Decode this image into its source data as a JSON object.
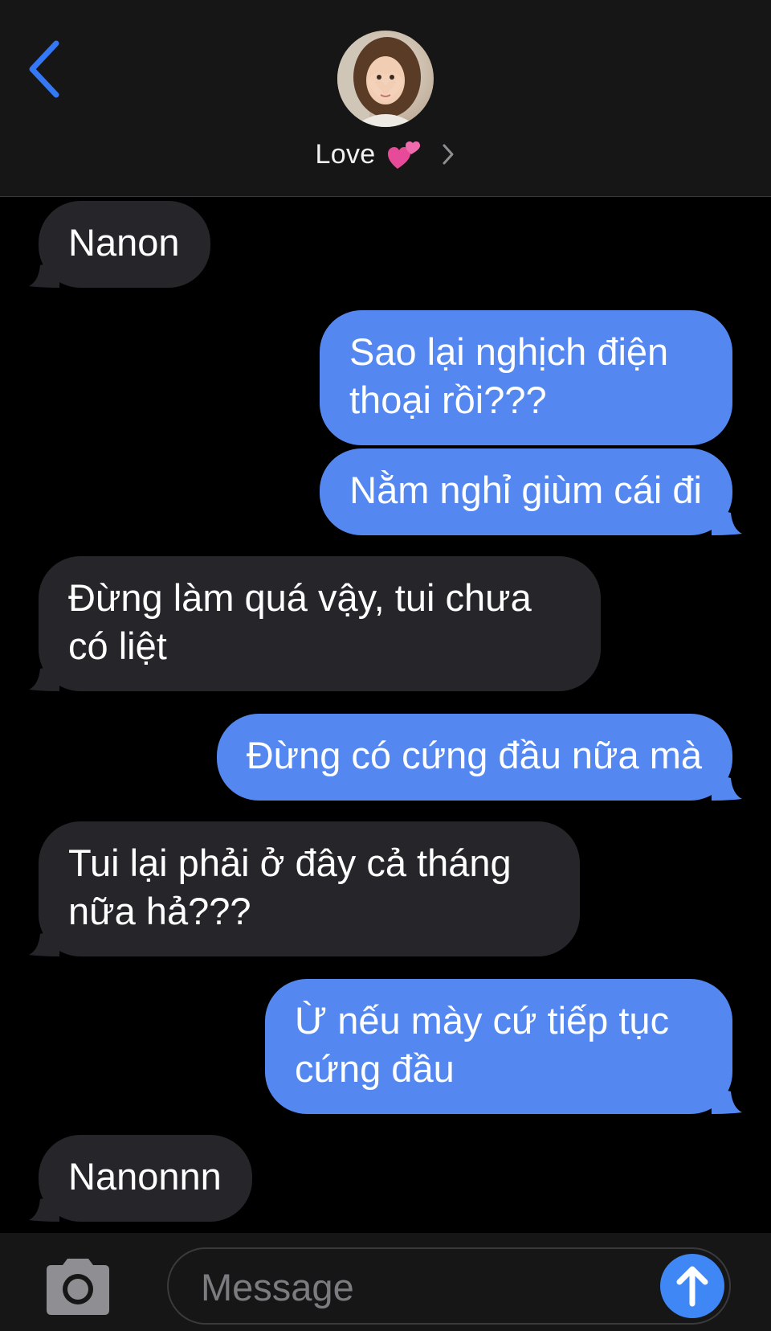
{
  "header": {
    "contact_name": "Love",
    "contact_emoji": "two-hearts-icon",
    "accent_color": "#3478f6"
  },
  "messages": [
    {
      "direction": "incoming",
      "text": "Nanon"
    },
    {
      "direction": "outgoing",
      "text": "Sao lại nghịch điện\nthoại rồi???"
    },
    {
      "direction": "outgoing",
      "text": "Nằm nghỉ giùm cái đi"
    },
    {
      "direction": "incoming",
      "text": "Đừng làm quá vậy, tui chưa\ncó liệt"
    },
    {
      "direction": "outgoing",
      "text": "Đừng có cứng đầu nữa mà"
    },
    {
      "direction": "incoming",
      "text": "Tui lại phải ở đây cả tháng\nnữa hả???"
    },
    {
      "direction": "outgoing",
      "text": "Ừ nếu mày cứ tiếp tục\ncứng đầu"
    },
    {
      "direction": "incoming",
      "text": "Nanonnn"
    }
  ],
  "input": {
    "placeholder": "Message"
  },
  "colors": {
    "incoming_bubble": "#26262a",
    "outgoing_bubble": "#5487ef",
    "send_button": "#3f87f5"
  }
}
